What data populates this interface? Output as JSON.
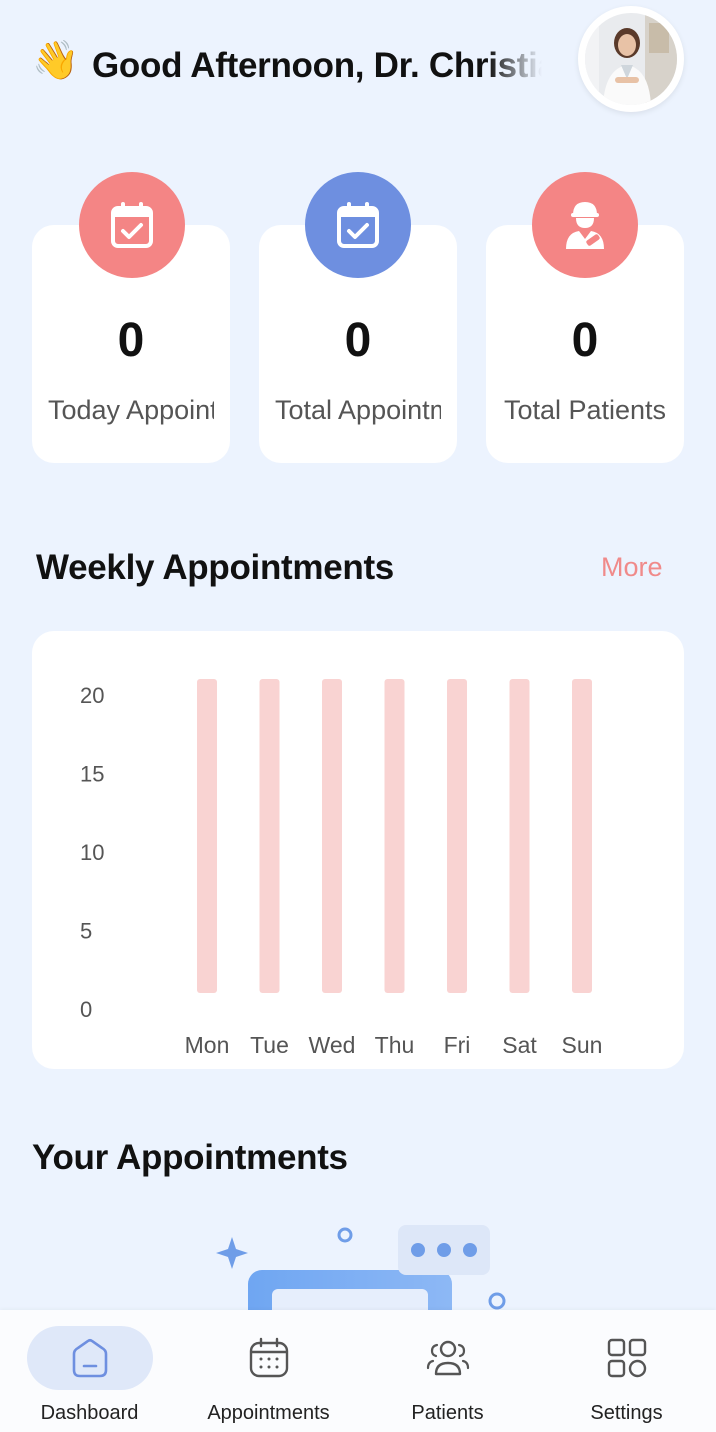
{
  "header": {
    "wave_emoji": "👋",
    "greeting": "Good Afternoon, Dr. Christian"
  },
  "stats": [
    {
      "value": "0",
      "label": "Today Appointments",
      "icon": "calendar-check-icon",
      "color": "#f48585"
    },
    {
      "value": "0",
      "label": "Total Appointments",
      "icon": "calendar-check-icon",
      "color": "#6e8fe0"
    },
    {
      "value": "0",
      "label": "Total Patients",
      "icon": "patient-icon",
      "color": "#f48585"
    }
  ],
  "weekly": {
    "title": "Weekly Appointments",
    "more": "More"
  },
  "chart_data": {
    "type": "bar",
    "categories": [
      "Mon",
      "Tue",
      "Wed",
      "Thu",
      "Fri",
      "Sat",
      "Sun"
    ],
    "values": [
      20,
      20,
      20,
      20,
      20,
      20,
      20
    ],
    "yticks": [
      0,
      5,
      10,
      15,
      20
    ],
    "ylim": [
      0,
      20
    ],
    "bar_color": "#f9d3d2",
    "grid": false
  },
  "appointments": {
    "title": "Your Appointments"
  },
  "nav": {
    "items": [
      {
        "label": "Dashboard",
        "icon": "home-icon",
        "active": true
      },
      {
        "label": "Appointments",
        "icon": "calendar-icon",
        "active": false
      },
      {
        "label": "Patients",
        "icon": "users-icon",
        "active": false
      },
      {
        "label": "Settings",
        "icon": "grid-icon",
        "active": false
      }
    ]
  },
  "colors": {
    "background": "#ecf3fe",
    "accent_red": "#f48585",
    "accent_blue": "#6e8fe0",
    "more_link": "#f08a8a"
  }
}
